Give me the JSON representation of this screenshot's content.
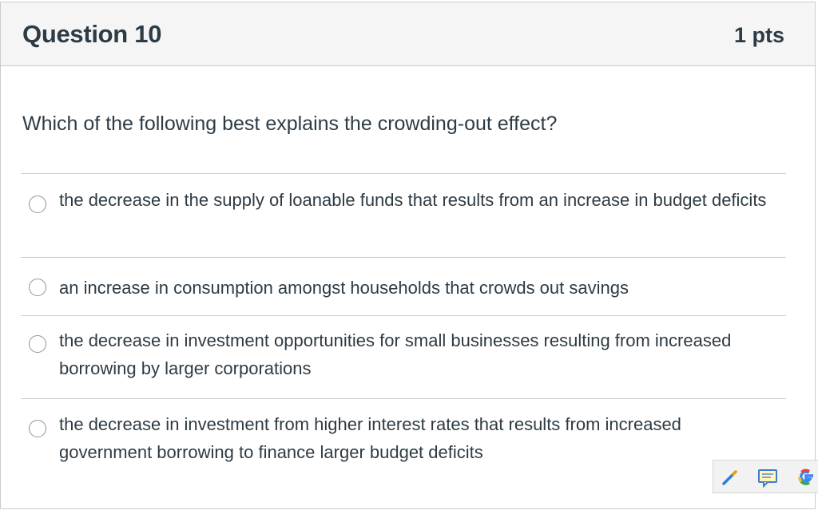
{
  "question": {
    "title": "Question 10",
    "points": "1 pts",
    "prompt": "Which of the following best explains the crowding-out effect?"
  },
  "answers": [
    {
      "text": "the decrease in the supply of loanable funds that results from an increase in budget deficits",
      "selected": false
    },
    {
      "text": "an increase in consumption amongst households that crowds out savings",
      "selected": false
    },
    {
      "text": "the decrease in investment opportunities for small businesses resulting from increased borrowing by larger corporations",
      "selected": false
    },
    {
      "text": "the decrease in investment from higher interest rates that results from increased government borrowing to finance larger budget deficits",
      "selected": false
    }
  ],
  "toolbar": {
    "icons": [
      "pencil-icon",
      "comment-icon",
      "google-icon"
    ]
  },
  "colors": {
    "header_bg": "#f5f5f5",
    "text": "#2d3b45",
    "border": "#c7cdd1"
  }
}
